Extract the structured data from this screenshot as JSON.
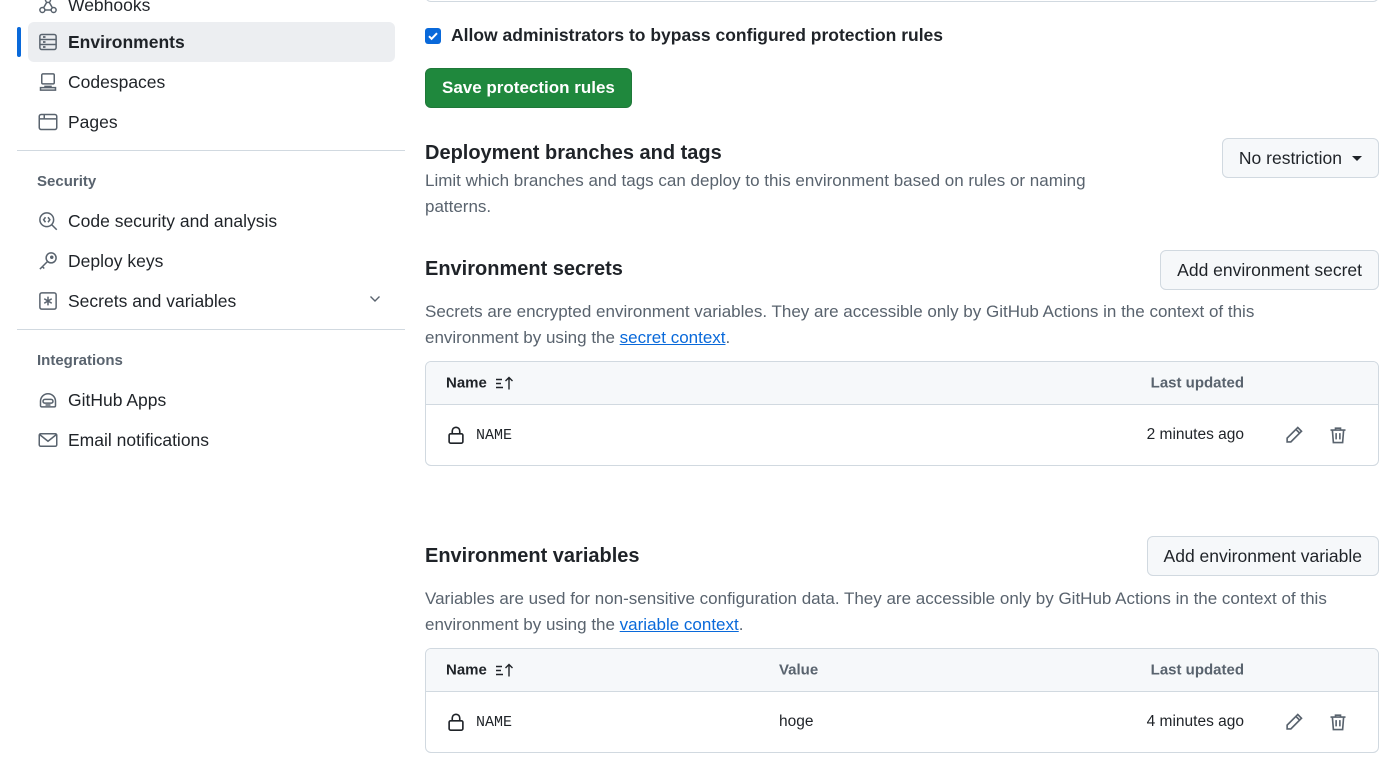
{
  "sidebar": {
    "items": [
      {
        "label": "Webhooks",
        "icon": "webhook-icon"
      },
      {
        "label": "Environments",
        "icon": "server-icon",
        "active": true
      },
      {
        "label": "Codespaces",
        "icon": "codespaces-icon"
      },
      {
        "label": "Pages",
        "icon": "browser-icon"
      }
    ],
    "security_title": "Security",
    "security_items": [
      {
        "label": "Code security and analysis",
        "icon": "codescan-icon"
      },
      {
        "label": "Deploy keys",
        "icon": "key-icon"
      },
      {
        "label": "Secrets and variables",
        "icon": "key-asterisk-icon"
      }
    ],
    "integrations_title": "Integrations",
    "integrations_items": [
      {
        "label": "GitHub Apps",
        "icon": "hubot-icon"
      },
      {
        "label": "Email notifications",
        "icon": "mail-icon"
      }
    ]
  },
  "protection": {
    "bypass_label": "Allow administrators to bypass configured protection rules",
    "bypass_checked": true,
    "save_label": "Save protection rules"
  },
  "deployment": {
    "title": "Deployment branches and tags",
    "description": "Limit which branches and tags can deploy to this environment based on rules or naming patterns.",
    "dropdown_label": "No restriction"
  },
  "secrets": {
    "title": "Environment secrets",
    "add_label": "Add environment secret",
    "description_prefix": "Secrets are encrypted environment variables. They are accessible only by GitHub Actions in the context of this environment by using the ",
    "link_text": "secret context",
    "description_suffix": ".",
    "columns": {
      "name": "Name",
      "updated": "Last updated"
    },
    "rows": [
      {
        "name": "NAME",
        "updated": "2 minutes ago"
      }
    ]
  },
  "variables": {
    "title": "Environment variables",
    "add_label": "Add environment variable",
    "description_prefix": "Variables are used for non-sensitive configuration data. They are accessible only by GitHub Actions in the context of this environment by using the ",
    "link_text": "variable context",
    "description_suffix": ".",
    "columns": {
      "name": "Name",
      "value": "Value",
      "updated": "Last updated"
    },
    "rows": [
      {
        "name": "NAME",
        "value": "hoge",
        "updated": "4 minutes ago"
      }
    ]
  },
  "colors": {
    "accent": "#0969da",
    "primary_button": "#1f883d",
    "active_bg": "#eceef1"
  }
}
